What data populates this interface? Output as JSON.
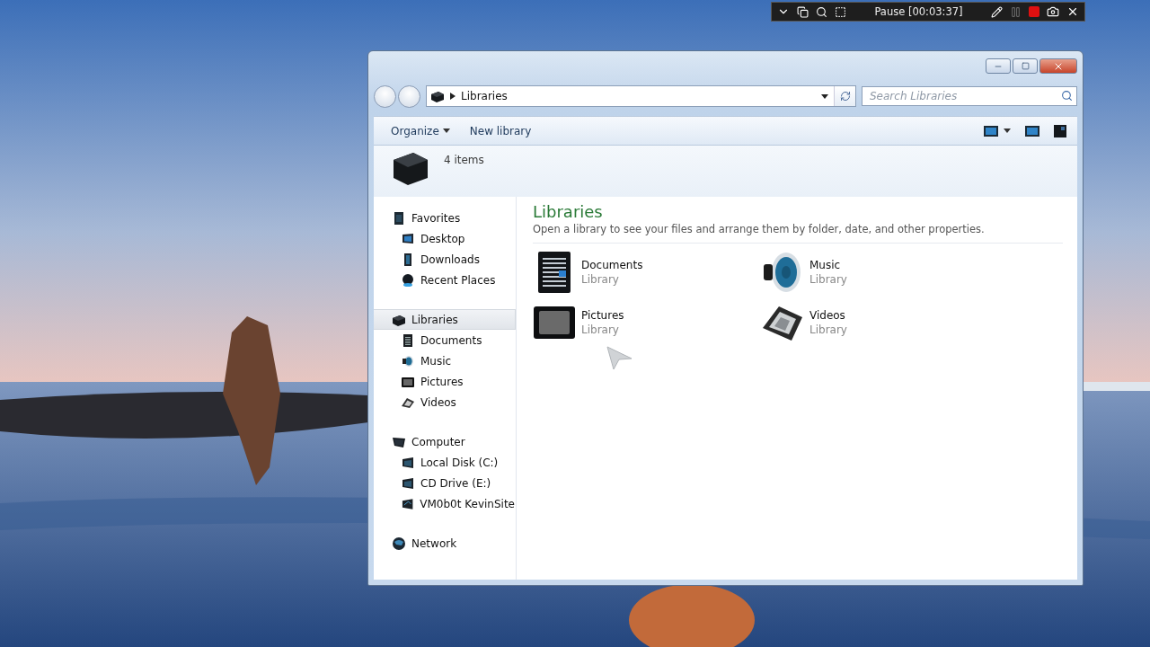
{
  "recorder": {
    "status": "Pause [00:03:37]",
    "recording": true
  },
  "window": {
    "address": {
      "crumb": "Libraries"
    },
    "search": {
      "placeholder": "Search Libraries"
    },
    "toolbar": [
      {
        "label": "Organize",
        "dropdown": true
      },
      {
        "label": "New library",
        "dropdown": false
      }
    ],
    "details": {
      "count": "4 items"
    },
    "sidebar": [
      {
        "label": "Favorites",
        "kind": "favorites",
        "selected": false,
        "children": [
          {
            "label": "Desktop",
            "kind": "desktop",
            "selected": false
          },
          {
            "label": "Downloads",
            "kind": "downloads",
            "selected": false
          },
          {
            "label": "Recent Places",
            "kind": "recent",
            "selected": false
          }
        ]
      },
      {
        "label": "Libraries",
        "kind": "libraries",
        "selected": true,
        "children": [
          {
            "label": "Documents",
            "kind": "documents",
            "selected": false
          },
          {
            "label": "Music",
            "kind": "music",
            "selected": false
          },
          {
            "label": "Pictures",
            "kind": "pictures",
            "selected": false
          },
          {
            "label": "Videos",
            "kind": "videos",
            "selected": false
          }
        ]
      },
      {
        "label": "Computer",
        "kind": "computer",
        "selected": false,
        "children": [
          {
            "label": "Local Disk (C:)",
            "kind": "disk",
            "selected": false
          },
          {
            "label": "CD Drive (E:)",
            "kind": "disk",
            "selected": false
          },
          {
            "label": "VM0b0t KevinSite",
            "kind": "netdrive",
            "selected": false
          }
        ]
      },
      {
        "label": "Network",
        "kind": "network",
        "selected": false
      }
    ],
    "content": {
      "title": "Libraries",
      "description": "Open a library to see your files and arrange them by folder, date, and other properties.",
      "items": [
        {
          "name": "Documents",
          "type": "Library",
          "kind": "documents"
        },
        {
          "name": "Music",
          "type": "Library",
          "kind": "music"
        },
        {
          "name": "Pictures",
          "type": "Library",
          "kind": "pictures"
        },
        {
          "name": "Videos",
          "type": "Library",
          "kind": "videos"
        }
      ]
    }
  }
}
